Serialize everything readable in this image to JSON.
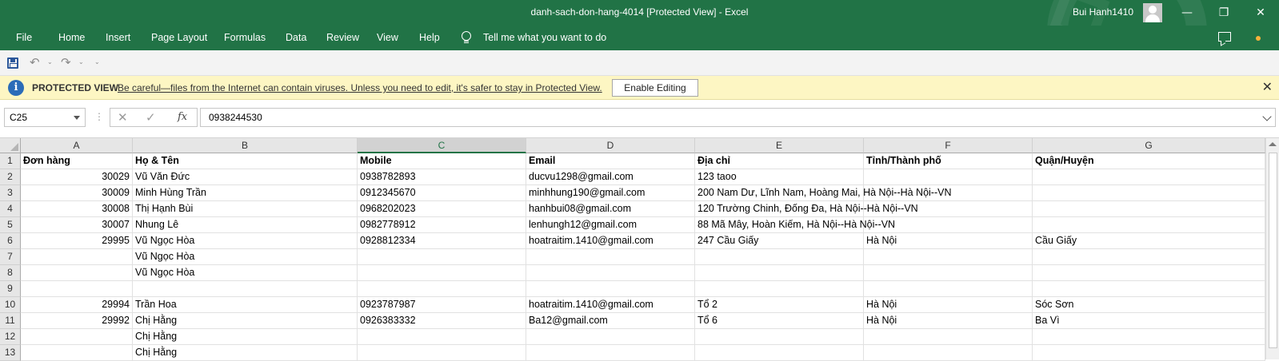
{
  "window": {
    "title": "danh-sach-don-hang-4014  [Protected View]  -  Excel",
    "user": "Bui Hanh1410",
    "minimize": "—",
    "restore": "❐",
    "close": "✕"
  },
  "ribbon": {
    "tabs": [
      "File",
      "Home",
      "Insert",
      "Page Layout",
      "Formulas",
      "Data",
      "Review",
      "View",
      "Help"
    ],
    "tell_me": "Tell me what you want to do"
  },
  "qat": {
    "undo": "↶",
    "redo": "↷",
    "customize": "⌄"
  },
  "protected_view": {
    "label": "PROTECTED VIEW",
    "message": "Be careful—files from the Internet can contain viruses. Unless you need to edit, it's safer to stay in Protected View.",
    "enable_button": "Enable Editing",
    "close": "✕"
  },
  "formula_bar": {
    "name_box": "C25",
    "dots": "⋮",
    "cancel": "✕",
    "enter": "✓",
    "fx": "fx",
    "value": "0938244530"
  },
  "sheet": {
    "columns": [
      "A",
      "B",
      "C",
      "D",
      "E",
      "F",
      "G"
    ],
    "selected_column": "C",
    "rows": [
      [
        "Đơn hàng",
        "Họ & Tên",
        "Mobile",
        "Email",
        "Địa chỉ",
        "Tỉnh/Thành phố",
        "Quận/Huyện"
      ],
      [
        "30029",
        "Vũ Văn Đức",
        "0938782893",
        "ducvu1298@gmail.com",
        "123 taoo",
        "",
        ""
      ],
      [
        "30009",
        "Minh Hùng Trần",
        "0912345670",
        "minhhung190@gmail.com",
        "200 Nam Dư, Lĩnh Nam, Hoàng Mai, Hà Nội--Hà Nội--VN",
        "",
        ""
      ],
      [
        "30008",
        "Thị Hạnh Bùi",
        "0968202023",
        "hanhbui08@gmail.com",
        "120 Trường Chinh, Đống Đa, Hà Nội--Hà Nội--VN",
        "",
        ""
      ],
      [
        "30007",
        "Nhung Lê",
        "0982778912",
        "lenhungh12@gmail.com",
        "88 Mã Mây, Hoàn Kiếm, Hà Nội--Hà Nội--VN",
        "",
        ""
      ],
      [
        "29995",
        "Vũ Ngọc Hòa",
        "0928812334",
        "hoatraitim.1410@gmail.com",
        "247 Cầu Giấy",
        "Hà Nội",
        "Cầu Giấy"
      ],
      [
        "",
        "Vũ Ngọc Hòa",
        "",
        "",
        "",
        "",
        ""
      ],
      [
        "",
        "Vũ Ngọc Hòa",
        "",
        "",
        "",
        "",
        ""
      ],
      [
        "",
        "",
        "",
        "",
        "",
        "",
        ""
      ],
      [
        "29994",
        "Trần Hoa",
        "0923787987",
        "hoatraitim.1410@gmail.com",
        "Tổ 2",
        "Hà Nội",
        "Sóc Sơn"
      ],
      [
        "29992",
        "Chị Hằng",
        "0926383332",
        "Ba12@gmail.com",
        "Tổ 6",
        "Hà Nội",
        "Ba Vì"
      ],
      [
        "",
        "Chị Hằng",
        "",
        "",
        "",
        "",
        ""
      ],
      [
        "",
        "Chị Hằng",
        "",
        "",
        "",
        "",
        ""
      ]
    ]
  },
  "icons": {
    "save": "save-icon",
    "info": "info-icon",
    "tell_me": "lightbulb-icon",
    "comments": "comment-icon"
  },
  "colors": {
    "excel_green": "#217346",
    "warning_bar": "#fdf6c3"
  }
}
